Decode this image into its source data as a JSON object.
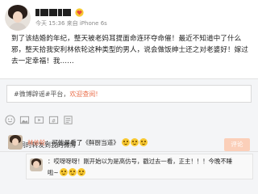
{
  "post": {
    "meta": "今天 15:36 来自 iPhone 6s",
    "body": "到了该结婚的年纪，整天被老妈耳提面命连环夺命催！最近不知道中了什么邪，整天拾我安利林依轮这种类型的男人，说会做饭绅士还之对老婆好！嫁过去一定幸福！我……"
  },
  "comment_panel": {
    "promo_prefix": "#微博辟谣#平台，",
    "promo_link": "欢迎查阅!",
    "sync_label": "同时转发到我的微博",
    "submit_label": "评论"
  },
  "comments": [
    {
      "user": "林依轮",
      "text": "：可能是看了《鲜厨当道》",
      "emoji_count": 3
    }
  ],
  "reply": {
    "line1": "：哎呀呀呀！刚开始以为是高仿号，戳过去一看，正主！！！今晚不睡",
    "line2": "啦~"
  },
  "icons": [
    "emoji-icon",
    "image-icon",
    "video-icon",
    "topic-icon",
    "list-icon"
  ],
  "colors": {
    "link": "#eb7350",
    "submit_bg": "#fbcfb9"
  }
}
